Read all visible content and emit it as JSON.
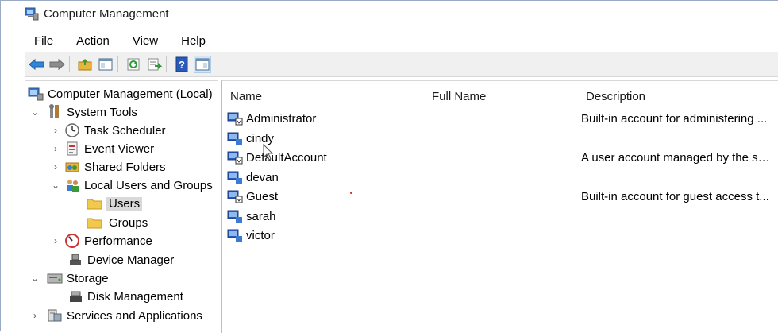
{
  "window": {
    "title": "Computer Management"
  },
  "menu": [
    "File",
    "Action",
    "View",
    "Help"
  ],
  "toolbar": {
    "buttons": [
      "back-arrow-icon",
      "forward-arrow-icon",
      "up-folder-icon",
      "show-hide-tree-icon",
      "refresh-icon",
      "export-list-icon",
      "help-icon",
      "action-pane-icon"
    ]
  },
  "tree": {
    "root": "Computer Management (Local)",
    "system_tools": "System Tools",
    "task_scheduler": "Task Scheduler",
    "event_viewer": "Event Viewer",
    "shared_folders": "Shared Folders",
    "local_users_groups": "Local Users and Groups",
    "users": "Users",
    "groups": "Groups",
    "performance": "Performance",
    "device_manager": "Device Manager",
    "storage": "Storage",
    "disk_management": "Disk Management",
    "services_apps": "Services and Applications"
  },
  "list": {
    "columns": {
      "name": "Name",
      "full_name": "Full Name",
      "description": "Description"
    },
    "rows": [
      {
        "name": "Administrator",
        "full_name": "",
        "description": "Built-in account for administering ..."
      },
      {
        "name": "cindy",
        "full_name": "",
        "description": ""
      },
      {
        "name": "DefaultAccount",
        "full_name": "",
        "description": "A user account managed by the sy..."
      },
      {
        "name": "devan",
        "full_name": "",
        "description": ""
      },
      {
        "name": "Guest",
        "full_name": "",
        "description": "Built-in account for guest access t..."
      },
      {
        "name": "sarah",
        "full_name": "",
        "description": ""
      },
      {
        "name": "victor",
        "full_name": "",
        "description": ""
      }
    ]
  },
  "colors": {
    "accent": "#2a6ebf",
    "selection": "#d9d9d9",
    "folder": "#f2c94c"
  }
}
